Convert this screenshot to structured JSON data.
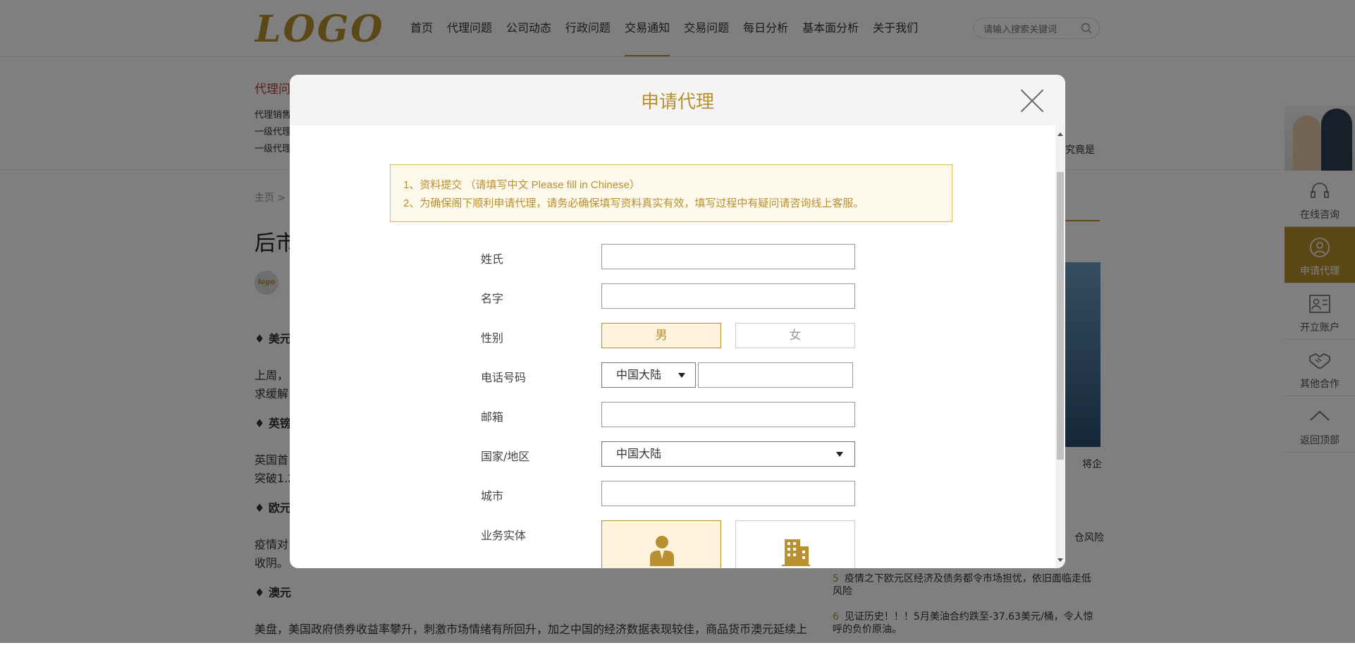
{
  "brand": {
    "logo_text": "LOGO",
    "accent_color": "#b8902f"
  },
  "nav": {
    "items": [
      "首页",
      "代理问题",
      "公司动态",
      "行政问题",
      "交易通知",
      "交易问题",
      "每日分析",
      "基本面分析",
      "关于我们"
    ],
    "active_index": 4
  },
  "search": {
    "placeholder": "请输入搜索关键词"
  },
  "background_page": {
    "category_title": "代理问",
    "category_lines": [
      "代理销售",
      "一级代理",
      "一级代理"
    ],
    "breadcrumb_home": "主页 >",
    "article_title": "后市",
    "article_headings": [
      "♦ 美元",
      "♦ 英镑",
      "♦ 欧元",
      "♦ 澳元"
    ],
    "article_text": [
      "上周，",
      "求缓解",
      "英国首",
      "突破1.2",
      "疫情对",
      "收阴。",
      "美盘，美国政府债券收益率攀升，刺激市场情绪有所回升，加之中国的经济数据表现较佳，商品货币澳元延续上"
    ],
    "side_snippets": [
      "究竟是",
      "将企",
      "仓风险"
    ],
    "news": [
      {
        "num": "5",
        "text": "疫情之下欧元区经济及债务都令市场担忧，依旧面临走低风险"
      },
      {
        "num": "6",
        "text": "见证历史！！！5月美油合约跌至-37.63美元/桶，令人惊呼的负价原油。"
      }
    ]
  },
  "right_rail": {
    "items": [
      {
        "label": "在线咨询",
        "icon": "headset-icon",
        "active": false
      },
      {
        "label": "申请代理",
        "icon": "user-icon",
        "active": true
      },
      {
        "label": "开立账户",
        "icon": "id-card-icon",
        "active": false
      },
      {
        "label": "其他合作",
        "icon": "handshake-icon",
        "active": false
      },
      {
        "label": "返回顶部",
        "icon": "chevron-up-icon",
        "active": false
      }
    ]
  },
  "modal": {
    "title": "申请代理",
    "notice": [
      "1、资料提交 （请填写中文 Please fill in Chinese）",
      "2、为确保阁下顺利申请代理，请务必确保填写资料真实有效，填写过程中有疑问请咨询线上客服。"
    ],
    "form": {
      "surname_label": "姓氏",
      "given_name_label": "名字",
      "gender_label": "性别",
      "gender_options": [
        "男",
        "女"
      ],
      "gender_selected": "男",
      "phone_label": "电话号码",
      "phone_region": "中国大陆",
      "email_label": "邮箱",
      "country_label": "国家/地区",
      "country_value": "中国大陆",
      "city_label": "城市",
      "entity_label": "业务实体",
      "entity_options": [
        {
          "icon": "person-icon",
          "selected": true
        },
        {
          "icon": "building-icon",
          "selected": false
        }
      ]
    }
  }
}
